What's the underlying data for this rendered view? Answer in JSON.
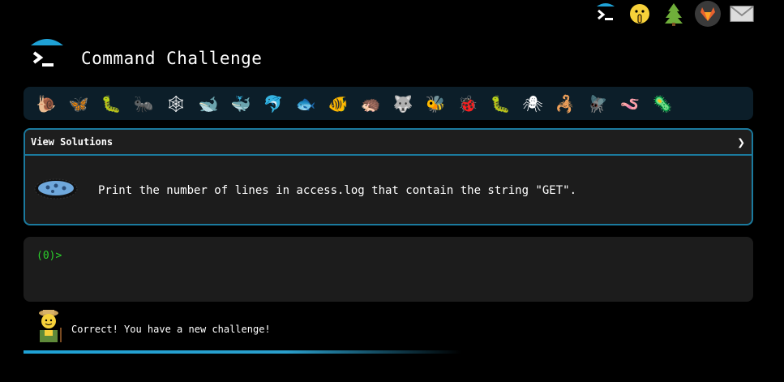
{
  "topbar": {
    "icons": [
      "terminal-icon",
      "shushing-face-icon",
      "tree-icon",
      "gitlab-icon",
      "mail-icon"
    ]
  },
  "header": {
    "title": "Command Challenge",
    "logo": "terminal-logo-icon"
  },
  "creatures": [
    "snail",
    "butterfly",
    "caterpillar",
    "ant",
    "spider-web",
    "whale",
    "whale-spout",
    "dolphin",
    "fish",
    "tropical-fish",
    "hedgehog",
    "wolf",
    "bee",
    "ladybug",
    "worm",
    "spider",
    "scorpion",
    "fly",
    "earthworm",
    "microbe"
  ],
  "challenge": {
    "header_label": "View Solutions",
    "chevron": "❯",
    "text": "Print the number of lines in access.log that contain the string \"GET\".",
    "icon": "microbe-icon"
  },
  "terminal": {
    "prompt": "(0)>",
    "input_value": ""
  },
  "status": {
    "message": "Correct! You have a new challenge!",
    "avatar": "farmer-icon"
  },
  "colors": {
    "accent": "#1b7a9e",
    "prompt_green": "#2bd12b",
    "panel_bg": "#1c1c1c",
    "bar_bg": "#0c1e29"
  }
}
